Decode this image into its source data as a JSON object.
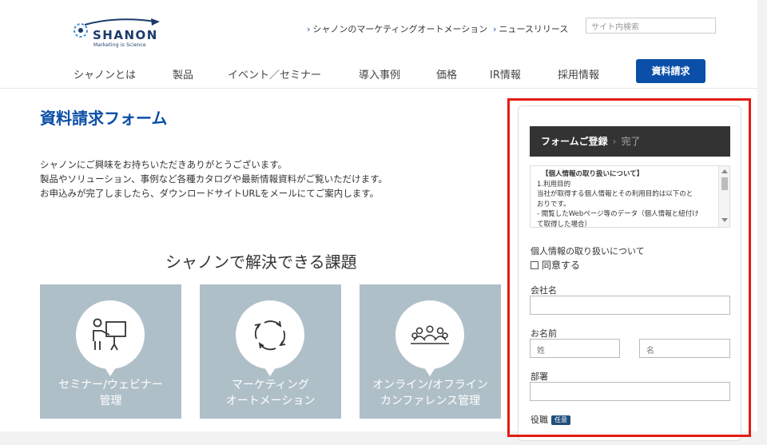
{
  "brand": {
    "name": "SHANON",
    "tagline": "Marketing is Science",
    "accent": "#0b4fa8",
    "highlight": "#e41b13"
  },
  "header": {
    "links": [
      {
        "label": "シャノンのマーケティングオートメーション"
      },
      {
        "label": "ニュースリリース"
      }
    ],
    "search_placeholder": "サイト内検索",
    "nav": [
      "シャノンとは",
      "製品",
      "イベント／セミナー",
      "導入事例",
      "価格",
      "IR情報",
      "採用情報"
    ],
    "cta": "資料請求"
  },
  "main": {
    "title": "資料請求フォーム",
    "intro": [
      "シャノンにご興味をお持ちいただきありがとうございます。",
      "製品やソリューション、事例など各種カタログや最新情報資料がご覧いただけます。",
      "お申込みが完了しましたら、ダウンロードサイトURLをメールにてご案内します。"
    ],
    "section_title": "シャノンで解決できる課題",
    "cards": [
      {
        "line1": "セミナー/ウェビナー",
        "line2": "管理",
        "icon": "presentation-icon"
      },
      {
        "line1": "マーケティング",
        "line2": "オートメーション",
        "icon": "cycle-arrows-icon"
      },
      {
        "line1": "オンライン/オフライン",
        "line2": "カンファレンス管理",
        "icon": "audience-icon"
      }
    ]
  },
  "form": {
    "steps": {
      "current": "フォームご登録",
      "sep": "›",
      "next": "完了"
    },
    "privacy": {
      "title": "【個人情報の取り扱いについて】",
      "lines": [
        "1.利用目的",
        "当社が取得する個人情報とその利用目的は以下のと",
        "おりです。",
        "- 閲覧したWebページ等のデータ（個人情報と紐付け",
        "て取得した場合）"
      ]
    },
    "privacy_label": "個人情報の取り扱いについて",
    "agree_label": "同意する",
    "company_label": "会社名",
    "name_label": "お名前",
    "last_name_placeholder": "姓",
    "first_name_placeholder": "名",
    "dept_label": "部署",
    "position_label": "役職",
    "optional_tag": "任意"
  }
}
